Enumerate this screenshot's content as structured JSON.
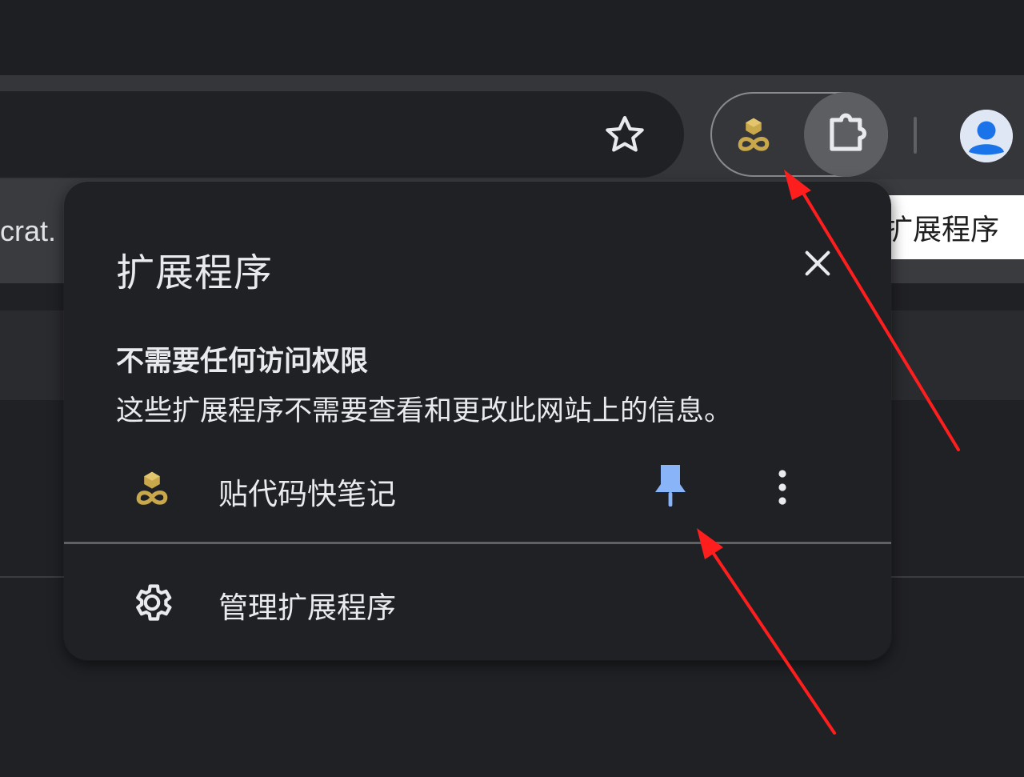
{
  "page": {
    "partial_text": "crat."
  },
  "toolbar": {
    "bookmark_icon": "star-icon",
    "pinned_extension_icon": "tiedaima-logo-icon",
    "extensions_icon": "puzzle-icon",
    "profile_icon": "profile-avatar-icon",
    "tooltip": "扩展程序"
  },
  "popup": {
    "title": "扩展程序",
    "close_icon": "close-icon",
    "section_heading": "不需要任何访问权限",
    "section_description": "这些扩展程序不需要查看和更改此网站上的信息。",
    "extensions": [
      {
        "name": "贴代码快笔记",
        "icon": "tiedaima-logo-icon",
        "pinned": true,
        "pin_icon": "pin-icon",
        "menu_icon": "more-vert-icon"
      }
    ],
    "manage_label": "管理扩展程序",
    "manage_icon": "gear-icon"
  },
  "colors": {
    "pin_active": "#8ab4f8",
    "logo_gold": "#c9a74b",
    "annotation_arrow": "#ff1e1e",
    "avatar_blue": "#1a73e8"
  }
}
